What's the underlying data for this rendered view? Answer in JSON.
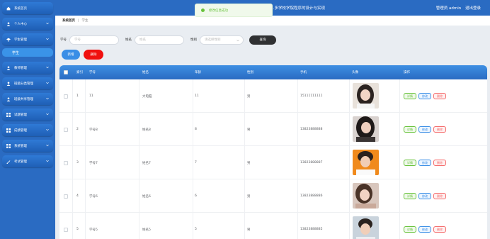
{
  "header": {
    "system_title": "…多学校学院程序的设计与实现",
    "admin_label": "管理员 admin",
    "logout": "退出登录"
  },
  "toast": {
    "message": "修改信息成功"
  },
  "sidebar": {
    "items": [
      {
        "label": "系统首页",
        "icon": "home-icon"
      },
      {
        "label": "个人中心",
        "icon": "user-icon"
      },
      {
        "label": "学生管理",
        "icon": "student-icon"
      },
      {
        "label": "教师管理",
        "icon": "teacher-icon"
      },
      {
        "label": "班级分类管理",
        "icon": "class-icon"
      },
      {
        "label": "班级共享管理",
        "icon": "share-icon"
      },
      {
        "label": "试题管理",
        "icon": "grid-icon"
      },
      {
        "label": "成绩管理",
        "icon": "grid-icon"
      },
      {
        "label": "系统管理",
        "icon": "grid-icon"
      },
      {
        "label": "考试管理",
        "icon": "exam-icon"
      }
    ],
    "active_sub": "学生"
  },
  "breadcrumb": {
    "home": "系统首页",
    "current": "学生"
  },
  "search": {
    "student_no_label": "学号",
    "student_no_placeholder": "学号",
    "name_label": "姓名",
    "name_placeholder": "姓名",
    "gender_label": "性别",
    "gender_placeholder": "请选择性别",
    "query_button": "查询"
  },
  "actions": {
    "add": "新增",
    "delete": "删除"
  },
  "table": {
    "columns": [
      "索引",
      "学号",
      "姓名",
      "年龄",
      "性别",
      "手机",
      "头像",
      "操作"
    ],
    "rows": [
      {
        "index": "1",
        "student_no": "11",
        "name": "大电脑",
        "age": "11",
        "gender": "男",
        "phone": "15111111111"
      },
      {
        "index": "2",
        "student_no": "学号8",
        "name": "姓名8",
        "age": "8",
        "gender": "男",
        "phone": "13823888888"
      },
      {
        "index": "3",
        "student_no": "学号7",
        "name": "姓名7",
        "age": "7",
        "gender": "男",
        "phone": "13823888887"
      },
      {
        "index": "4",
        "student_no": "学号6",
        "name": "姓名6",
        "age": "6",
        "gender": "男",
        "phone": "13823888886"
      },
      {
        "index": "5",
        "student_no": "学号5",
        "name": "姓名5",
        "age": "5",
        "gender": "男",
        "phone": "13823888885"
      }
    ],
    "row_actions": {
      "detail": "详情",
      "edit": "修改",
      "delete": "删除"
    }
  },
  "colors": {
    "primary": "#2a6bc2",
    "header_bar": "#3d8fe3",
    "danger": "#f0100f",
    "success": "#67c23a"
  }
}
